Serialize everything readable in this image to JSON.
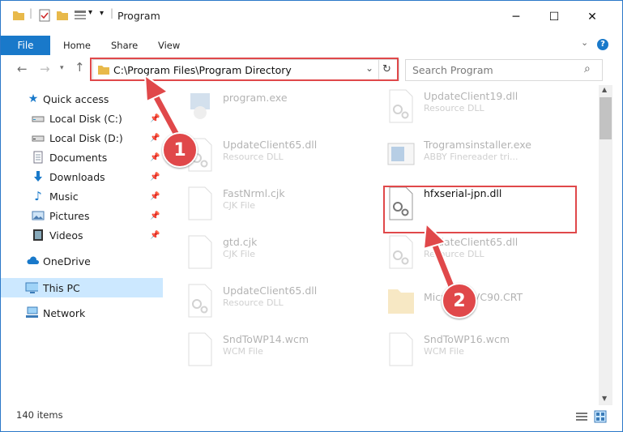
{
  "window": {
    "title": "Program",
    "minimize_glyph": "─",
    "maximize_glyph": "☐",
    "close_glyph": "✕"
  },
  "ribbon": {
    "tabs": [
      "File",
      "Home",
      "Share",
      "View"
    ],
    "expand_glyph": "⌄",
    "help_glyph": "?"
  },
  "address": {
    "path": "C:\\Program Files\\Program Directory",
    "dropdown_glyph": "⌄",
    "refresh_glyph": "↻"
  },
  "search": {
    "placeholder": "Search Program",
    "icon_glyph": "⌕"
  },
  "sidebar": {
    "items": [
      {
        "label": "Quick access",
        "icon": "star-icon",
        "pinned": false
      },
      {
        "label": "Local Disk (C:)",
        "icon": "drive-icon",
        "pinned": true
      },
      {
        "label": "Local Disk (D:)",
        "icon": "drive-icon",
        "pinned": true
      },
      {
        "label": "Documents",
        "icon": "documents-icon",
        "pinned": true
      },
      {
        "label": "Downloads",
        "icon": "download-icon",
        "pinned": true
      },
      {
        "label": "Music",
        "icon": "music-icon",
        "pinned": true
      },
      {
        "label": "Pictures",
        "icon": "pictures-icon",
        "pinned": true
      },
      {
        "label": "Videos",
        "icon": "videos-icon",
        "pinned": true
      },
      {
        "label": "OneDrive",
        "icon": "cloud-icon",
        "pinned": false
      },
      {
        "label": "This PC",
        "icon": "pc-icon",
        "pinned": false,
        "selected": true
      },
      {
        "label": "Network",
        "icon": "network-icon",
        "pinned": false
      }
    ],
    "pin_glyph": "📌"
  },
  "files": [
    {
      "name": "program.exe",
      "desc": "",
      "icon": "exe-icon"
    },
    {
      "name": "UpdateClient19.dll",
      "desc": "Resource DLL",
      "icon": "dll-icon"
    },
    {
      "name": "UpdateClient65.dll",
      "desc": "Resource DLL",
      "icon": "dll-icon"
    },
    {
      "name": "Trogramsinstaller.exe",
      "desc": "ABBY Finereader tri...",
      "icon": "installer-icon"
    },
    {
      "name": "FastNrml.cjk",
      "desc": "CJK File",
      "icon": "file-icon"
    },
    {
      "name": "hfxserial-jpn.dll",
      "desc": "",
      "icon": "dll-icon",
      "highlighted": true
    },
    {
      "name": "gtd.cjk",
      "desc": "CJK File",
      "icon": "file-icon"
    },
    {
      "name": "UpdateClient65.dll",
      "desc": "Resource DLL",
      "icon": "dll-icon"
    },
    {
      "name": "UpdateClient65.dll",
      "desc": "Resource DLL",
      "icon": "dll-icon"
    },
    {
      "name": "Microsoft.VC90.CRT",
      "desc": "",
      "icon": "folder-icon"
    },
    {
      "name": "SndToWP14.wcm",
      "desc": "WCM File",
      "icon": "file-icon"
    },
    {
      "name": "SndToWP16.wcm",
      "desc": "WCM File",
      "icon": "file-icon"
    }
  ],
  "status": {
    "item_count": "140 items"
  },
  "annotations": {
    "step1": "1",
    "step2": "2"
  },
  "colors": {
    "accent": "#1979ca",
    "highlight": "#e0484a",
    "selected": "#cce8ff"
  }
}
